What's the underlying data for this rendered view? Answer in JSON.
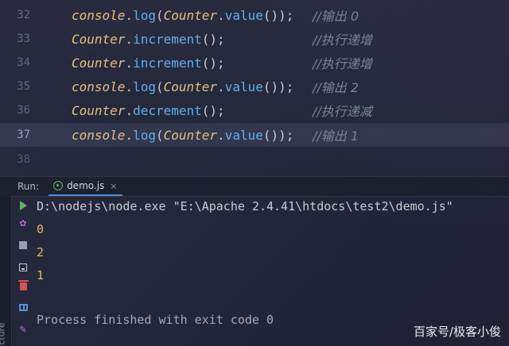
{
  "editor": {
    "lines": [
      {
        "num": "32",
        "code_obj": "console",
        "code_rest": ".",
        "code_fn": "log",
        "code_inner_obj": "Counter",
        "code_inner_fn": "value",
        "code_tail": "());",
        "comment": "//输出 0"
      },
      {
        "num": "33",
        "code_obj": "Counter",
        "code_rest": ".",
        "code_fn": "increment",
        "code_tail": "();",
        "comment": "//执行递增"
      },
      {
        "num": "34",
        "code_obj": "Counter",
        "code_rest": ".",
        "code_fn": "increment",
        "code_tail": "();",
        "comment": "//执行递增"
      },
      {
        "num": "35",
        "code_obj": "console",
        "code_rest": ".",
        "code_fn": "log",
        "code_inner_obj": "Counter",
        "code_inner_fn": "value",
        "code_tail": "());",
        "comment": "//输出 2"
      },
      {
        "num": "36",
        "code_obj": "Counter",
        "code_rest": ".",
        "code_fn": "decrement",
        "code_tail": "();",
        "comment": "//执行递减"
      },
      {
        "num": "37",
        "code_obj": "console",
        "code_rest": ".",
        "code_fn": "log",
        "code_inner_obj": "Counter",
        "code_inner_fn": "value",
        "code_tail": "());",
        "comment": "//输出 1"
      }
    ],
    "partial_line_num": "38",
    "current_line": "37"
  },
  "run_panel": {
    "label": "Run:",
    "tab_name": "demo.js",
    "tab_close": "×",
    "side_label": "cture",
    "toolbar_icons": [
      "play-icon",
      "gear-icon",
      "stop-icon",
      "dump-threads-icon",
      "trash-icon",
      "layout-icon",
      "pin-icon"
    ]
  },
  "console": {
    "command": "D:\\nodejs\\node.exe \"E:\\Apache 2.4.41\\htdocs\\test2\\demo.js\"",
    "outputs": [
      "0",
      "2",
      "1"
    ],
    "exit_message": "Process finished with exit code 0"
  },
  "watermark": "百家号/极客小俊",
  "colors": {
    "background": "#22283a",
    "object": "#e6c07b",
    "method": "#61afef",
    "comment": "#7a8599",
    "output": "#e5b85c",
    "run_green": "#5fb35f"
  }
}
